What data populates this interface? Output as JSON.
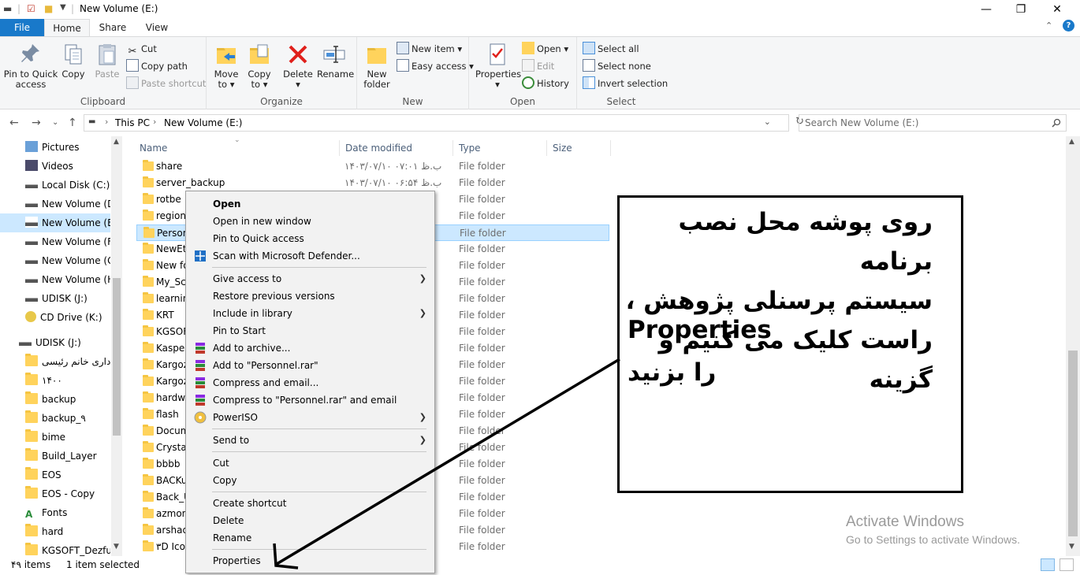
{
  "window": {
    "title": "New Volume (E:)"
  },
  "ribbon_tabs": [
    "File",
    "Home",
    "Share",
    "View"
  ],
  "ribbon": {
    "clipboard": {
      "label": "Clipboard",
      "pin": "Pin to Quick access",
      "copy": "Copy",
      "paste": "Paste",
      "cut": "Cut",
      "copy_path": "Copy path",
      "paste_shortcut": "Paste shortcut"
    },
    "organize": {
      "label": "Organize",
      "move_to": "Move to",
      "copy_to": "Copy to",
      "delete": "Delete",
      "rename": "Rename"
    },
    "new": {
      "label": "New",
      "new_folder": "New folder",
      "new_item": "New item",
      "easy_access": "Easy access"
    },
    "open": {
      "label": "Open",
      "properties": "Properties",
      "open": "Open",
      "edit": "Edit",
      "history": "History"
    },
    "select": {
      "label": "Select",
      "select_all": "Select all",
      "select_none": "Select none",
      "invert": "Invert selection"
    }
  },
  "address": {
    "path": [
      "This PC",
      "New Volume (E:)"
    ],
    "search_placeholder": "Search New Volume (E:)"
  },
  "nav_items": [
    {
      "label": "Pictures",
      "kind": "pictures"
    },
    {
      "label": "Videos",
      "kind": "videos"
    },
    {
      "label": "Local Disk (C:)",
      "kind": "drive"
    },
    {
      "label": "New Volume (D:)",
      "kind": "drive"
    },
    {
      "label": "New Volume (E:)",
      "kind": "drive"
    },
    {
      "label": "New Volume (F:)",
      "kind": "drive"
    },
    {
      "label": "New Volume (G:)",
      "kind": "drive"
    },
    {
      "label": "New Volume (H:)",
      "kind": "drive"
    },
    {
      "label": "UDISK (J:)",
      "kind": "drive"
    },
    {
      "label": "CD Drive (K:)",
      "kind": "cd"
    },
    {
      "label": "UDISK (J:)",
      "kind": "drive"
    },
    {
      "label": "اداری خانم رئیسی",
      "kind": "folder"
    },
    {
      "label": "۱۴۰۰",
      "kind": "folder"
    },
    {
      "label": "backup",
      "kind": "folder"
    },
    {
      "label": "backup_۹",
      "kind": "folder"
    },
    {
      "label": "bime",
      "kind": "folder"
    },
    {
      "label": "Build_Layer",
      "kind": "folder"
    },
    {
      "label": "EOS",
      "kind": "folder"
    },
    {
      "label": "EOS - Copy",
      "kind": "folder"
    },
    {
      "label": "Fonts",
      "kind": "fonts"
    },
    {
      "label": "hard",
      "kind": "folder"
    },
    {
      "label": "KGSOFT_Dezful",
      "kind": "folder"
    }
  ],
  "columns": {
    "name": "Name",
    "date": "Date modified",
    "type": "Type",
    "size": "Size"
  },
  "files": [
    {
      "name": "share",
      "date": "۱۴۰۳/۰۷/۱۰ ب.ظ ۰۷:۰۱",
      "type": "File folder"
    },
    {
      "name": "server_backup",
      "date": "۱۴۰۳/۰۷/۱۰ ب.ظ ۰۶:۵۴",
      "type": "File folder"
    },
    {
      "name": "rotbe",
      "date": "",
      "type": "File folder"
    },
    {
      "name": "region",
      "date": "",
      "type": "File folder"
    },
    {
      "name": "Person",
      "date": "",
      "type": "File folder"
    },
    {
      "name": "NewEts",
      "date": "",
      "type": "File folder"
    },
    {
      "name": "New fo",
      "date": "",
      "type": "File folder"
    },
    {
      "name": "My_Sca",
      "date": "",
      "type": "File folder"
    },
    {
      "name": "learnin",
      "date": "",
      "type": "File folder"
    },
    {
      "name": "KRT",
      "date": "",
      "type": "File folder"
    },
    {
      "name": "KGSOF",
      "date": "",
      "type": "File folder"
    },
    {
      "name": "Kaspers",
      "date": "",
      "type": "File folder"
    },
    {
      "name": "Kargoz",
      "date": "",
      "type": "File folder"
    },
    {
      "name": "Kargoz",
      "date": "",
      "type": "File folder"
    },
    {
      "name": "hardwa",
      "date": "",
      "type": "File folder"
    },
    {
      "name": "flash",
      "date": "",
      "type": "File folder"
    },
    {
      "name": "Docum",
      "date": "",
      "type": "File folder"
    },
    {
      "name": "Crystal_",
      "date": "",
      "type": "File folder"
    },
    {
      "name": "bbbb",
      "date": "",
      "type": "File folder"
    },
    {
      "name": "BACKu",
      "date": "",
      "type": "File folder"
    },
    {
      "name": "Back_U",
      "date": "",
      "type": "File folder"
    },
    {
      "name": "azmon",
      "date": "",
      "type": "File folder"
    },
    {
      "name": "arshad",
      "date": "",
      "type": "File folder"
    },
    {
      "name": "۳D Icon",
      "date": "",
      "type": "File folder"
    }
  ],
  "context_menu": {
    "open": "Open",
    "open_new_window": "Open in new window",
    "pin_quick": "Pin to Quick access",
    "scan": "Scan with Microsoft Defender...",
    "give_access": "Give access to",
    "restore": "Restore previous versions",
    "include_library": "Include in library",
    "pin_start": "Pin to Start",
    "add_archive": "Add to archive...",
    "add_rar": "Add to \"Personnel.rar\"",
    "compress_email": "Compress and email...",
    "compress_rar_email": "Compress to \"Personnel.rar\" and email",
    "poweriso": "PowerISO",
    "send_to": "Send to",
    "cut": "Cut",
    "copy": "Copy",
    "create_shortcut": "Create shortcut",
    "delete": "Delete",
    "rename": "Rename",
    "properties": "Properties"
  },
  "annotation": {
    "line1": "روی پوشه محل نصب برنامه",
    "line2": "سیستم پرسنلی پژوهش ،",
    "line3": "راست کلیک می کنیم و گزینه",
    "line4": "Properties",
    "line5": "را بزنید"
  },
  "watermark": {
    "title": "Activate Windows",
    "subtitle": "Go to Settings to activate Windows."
  },
  "status": {
    "items": "۴۹ items",
    "selected": "1 item selected"
  },
  "colors": {
    "accent": "#1979ca",
    "selection": "#cce8ff",
    "folder": "#ffd35c"
  }
}
